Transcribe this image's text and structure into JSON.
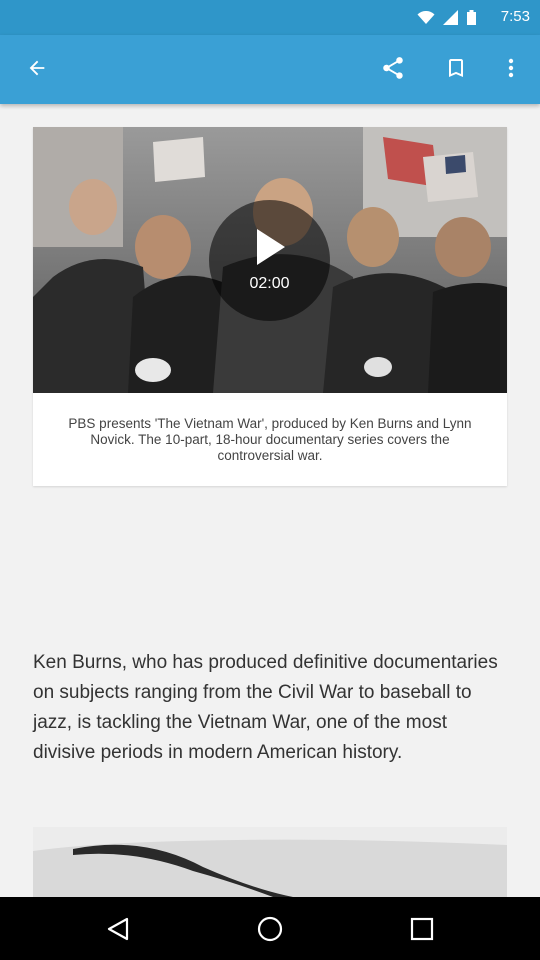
{
  "status_bar": {
    "time": "7:53",
    "icons": [
      "wifi-icon",
      "signal-icon",
      "battery-icon"
    ]
  },
  "toolbar": {
    "background_color": "#3aa0d5",
    "icons": [
      "back-arrow-icon",
      "share-icon",
      "bookmark-icon",
      "more-vert-icon"
    ]
  },
  "video": {
    "duration": "02:00",
    "caption": "PBS presents 'The Vietnam War', produced by Ken Burns and Lynn Novick. The 10-part, 18-hour documentary series covers the controversial war."
  },
  "article": {
    "paragraph": "Ken Burns, who has produced definitive documentaries on subjects ranging from the Civil War to baseball to jazz, is tackling the Vietnam War, one of the most divisive periods in modern American history."
  },
  "nav_bar": {
    "icons": [
      "nav-back-icon",
      "nav-home-icon",
      "nav-recent-icon"
    ]
  }
}
